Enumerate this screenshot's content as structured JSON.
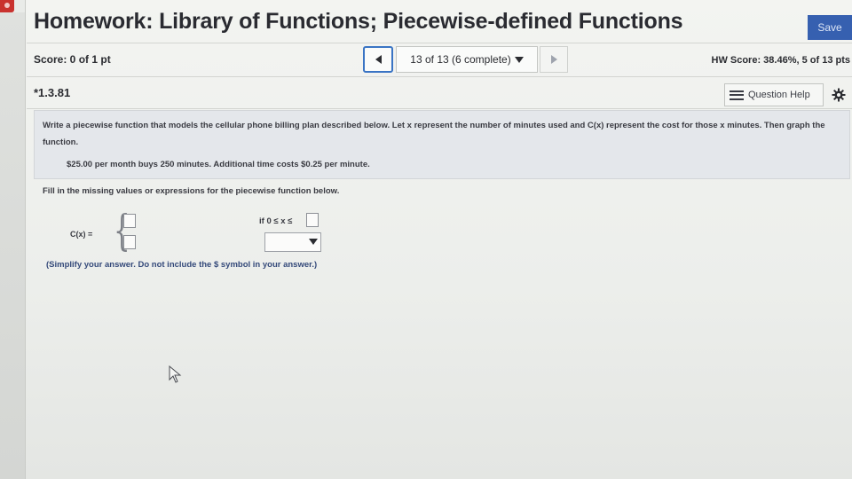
{
  "header": {
    "title": "Homework: Library of Functions; Piecewise-defined Functions",
    "save_label": "Save"
  },
  "nav": {
    "score": "Score: 0 of 1 pt",
    "question_select": "13 of 13 (6 complete)",
    "hw_score": "HW Score: 38.46%, 5 of 13 pts"
  },
  "question": {
    "id": "*1.3.81",
    "help_label": "Question Help",
    "prompt": "Write a piecewise function that models the cellular phone billing plan described below. Let x represent the number of minutes used and C(x) represent the cost for those x minutes. Then graph the function.",
    "plan_info": "$25.00 per month buys 250 minutes. Additional time costs $0.25 per minute.",
    "fill_instruction": "Fill in the missing values or expressions for the piecewise function below.",
    "function_label": "C(x) =",
    "condition_1": "if 0 ≤ x ≤",
    "note": "(Simplify your answer. Do not include the $ symbol in your answer.)"
  },
  "icons": {
    "prev": "chevron-left-icon",
    "next": "chevron-right-icon",
    "dropdown": "caret-down-icon",
    "help": "list-icon",
    "settings": "gear-icon"
  },
  "colors": {
    "save_button": "#3660b0",
    "active_border": "#3a74c4",
    "note_text": "#34497a"
  }
}
